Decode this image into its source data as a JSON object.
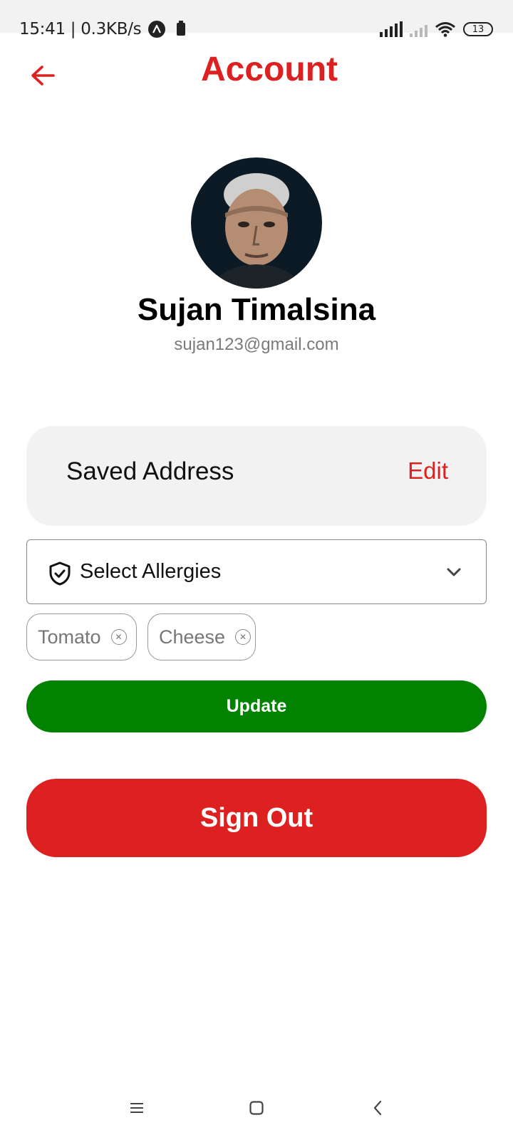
{
  "status_bar": {
    "time_speed": "15:41 | 0.3KB/s",
    "battery": "13"
  },
  "header": {
    "title": "Account"
  },
  "profile": {
    "name": "Sujan Timalsina",
    "email": "sujan123@gmail.com"
  },
  "address": {
    "label": "Saved Address",
    "edit_label": "Edit"
  },
  "allergies": {
    "select_label": "Select Allergies",
    "chips": [
      "Tomato",
      "Cheese"
    ]
  },
  "actions": {
    "update_label": "Update",
    "signout_label": "Sign Out"
  },
  "colors": {
    "accent_red": "#dd2121",
    "update_green": "#018301"
  }
}
